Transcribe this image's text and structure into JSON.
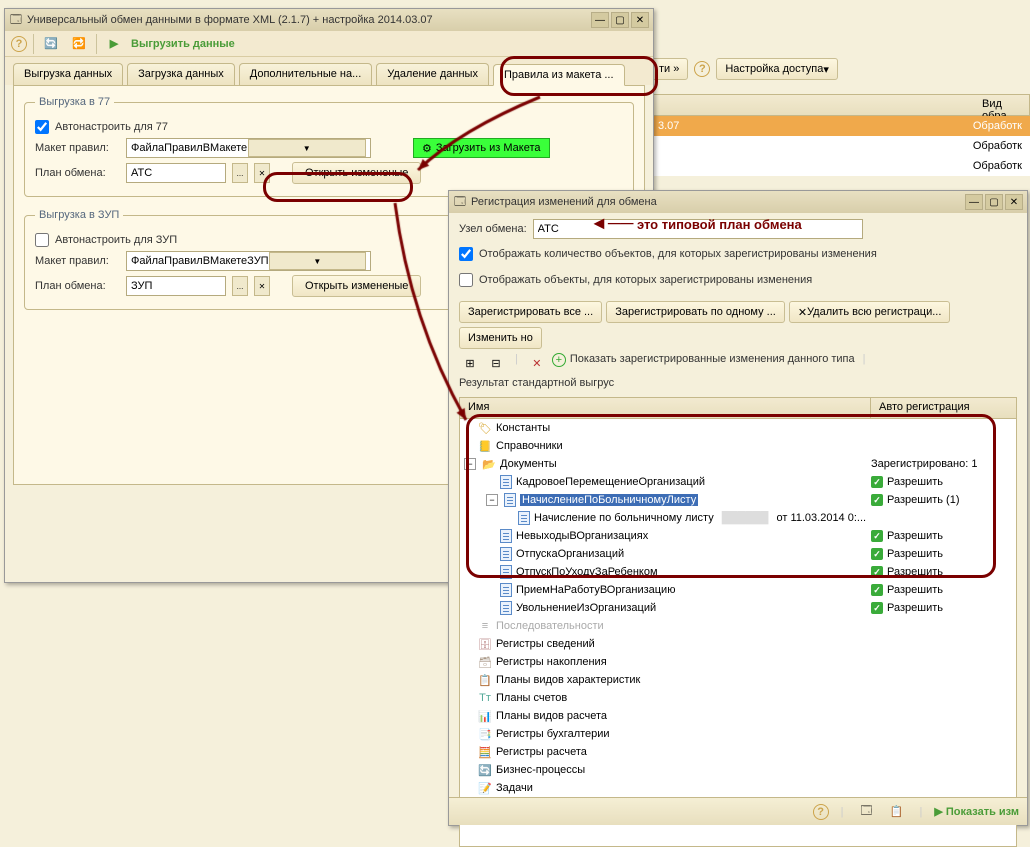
{
  "w1": {
    "title": "Универсальный обмен данными в формате XML (2.1.7) + настройка 2014.03.07",
    "action": "Выгрузить данные",
    "tabs": [
      "Выгрузка данных",
      "Загрузка данных",
      "Дополнительные на...",
      "Удаление данных",
      "Правила из макета ..."
    ],
    "fs77": {
      "legend": "Выгрузка в 77",
      "auto": "Автонастроить для 77",
      "maket_label": "Макет правил:",
      "maket_value": "ФайлаПравилВМакете",
      "plan_label": "План обмена:",
      "plan_value": "АТС",
      "open_btn": "Открыть измененые",
      "load_btn": "Загрузить из Макета"
    },
    "fszup": {
      "legend": "Выгрузка в ЗУП",
      "auto": "Автонастроить для ЗУП",
      "maket_label": "Макет правил:",
      "maket_value": "ФайлаПравилВМакетеЗУП",
      "plan_label": "План обмена:",
      "plan_value": "ЗУП",
      "open_btn": "Открыть измененые"
    }
  },
  "w2": {
    "title": "Регистрация изменений для обмена",
    "node_label": "Узел обмена:",
    "node_value": "АТС",
    "show_count": "Отображать количество объектов, для которых зарегистрированы изменения",
    "show_obj": "Отображать объекты, для которых зарегистрированы изменения",
    "btns": {
      "reg_all": "Зарегистрировать все ...",
      "reg_one": "Зарегистрировать по одному ...",
      "del_all": "Удалить всю регистраци...",
      "change": "Изменить но"
    },
    "show_reg": "Показать зарегистрированные изменения данного типа",
    "result": "Результат стандартной выгрус",
    "col_name": "Имя",
    "col_auto": "Авто регистрация",
    "tree": {
      "const": "Константы",
      "sprav": "Справочники",
      "docs": "Документы",
      "docs_reg": "Зарегистрировано: 1",
      "d1": "КадровоеПеремещениеОрганизаций",
      "d2": "НачислениеПоБольничномуЛисту",
      "d2_item": "Начисление по больничному листу",
      "d2_date": "от 11.03.2014 0:...",
      "d3": "НевыходыВОрганизациях",
      "d4": "ОтпускаОрганизаций",
      "d5": "ОтпускПоУходуЗаРебенком",
      "d6": "ПриемНаРаботуВОрганизацию",
      "d7": "УвольнениеИзОрганизаций",
      "posl": "Последовательности",
      "rsved": "Регистры сведений",
      "rnak": "Регистры накопления",
      "pvh": "Планы видов характеристик",
      "psch": "Планы счетов",
      "pvr": "Планы видов расчета",
      "rbuh": "Регистры бухгалтерии",
      "rrasch": "Регистры расчета",
      "biz": "Бизнес-процессы",
      "zad": "Задачи",
      "allow": "Разрешить",
      "allow1": "Разрешить (1)"
    },
    "footer": "Показать изм"
  },
  "bg": {
    "toolbar_arrow": "ти »",
    "setup": "Настройка доступа",
    "col": "Вид обра",
    "date": "3.07",
    "r1": "Обработк",
    "r2": "Обработк",
    "r3": "Обработк"
  },
  "annot": "это типовой план обмена"
}
